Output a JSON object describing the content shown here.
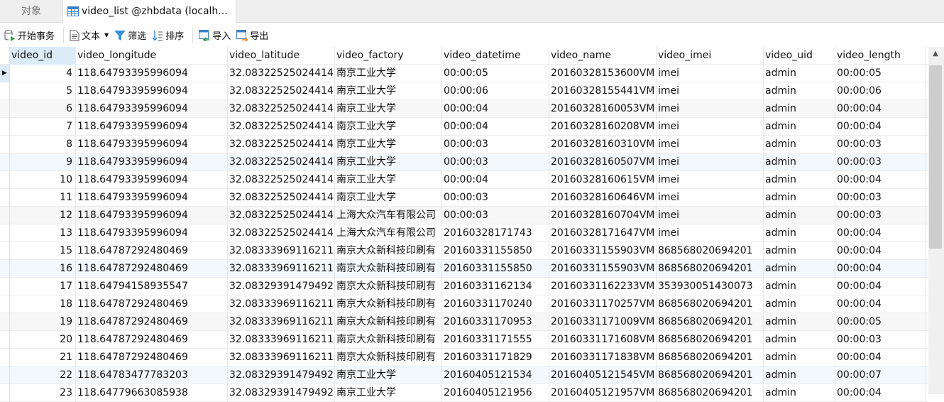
{
  "tabs": {
    "objects": "对象",
    "active": "video_list @zhbdata (localh..."
  },
  "toolbar": {
    "begin_transaction": "开始事务",
    "text": "文本",
    "filter": "筛选",
    "sort": "排序",
    "import": "导入",
    "export": "导出"
  },
  "columns": [
    "video_id",
    "video_longitude",
    "video_latitude",
    "video_factory",
    "video_datetime",
    "video_name",
    "video_imei",
    "video_uid",
    "video_length"
  ],
  "rows": [
    [
      "4",
      "118.64793395996094",
      "32.08322525024414",
      "南京工业大学",
      "00:00:05",
      "20160328153600VM",
      "imei",
      "admin",
      "00:00:05"
    ],
    [
      "5",
      "118.64793395996094",
      "32.08322525024414",
      "南京工业大学",
      "00:00:06",
      "20160328155441VM",
      "imei",
      "admin",
      "00:00:06"
    ],
    [
      "6",
      "118.64793395996094",
      "32.08322525024414",
      "南京工业大学",
      "00:00:04",
      "20160328160053VM",
      "imei",
      "admin",
      "00:00:04"
    ],
    [
      "7",
      "118.64793395996094",
      "32.08322525024414",
      "南京工业大学",
      "00:00:04",
      "20160328160208VM",
      "imei",
      "admin",
      "00:00:04"
    ],
    [
      "8",
      "118.64793395996094",
      "32.08322525024414",
      "南京工业大学",
      "00:00:03",
      "20160328160310VM",
      "imei",
      "admin",
      "00:00:03"
    ],
    [
      "9",
      "118.64793395996094",
      "32.08322525024414",
      "南京工业大学",
      "00:00:03",
      "20160328160507VM",
      "imei",
      "admin",
      "00:00:03"
    ],
    [
      "10",
      "118.64793395996094",
      "32.08322525024414",
      "南京工业大学",
      "00:00:04",
      "20160328160615VM",
      "imei",
      "admin",
      "00:00:04"
    ],
    [
      "11",
      "118.64793395996094",
      "32.08322525024414",
      "南京工业大学",
      "00:00:03",
      "20160328160646VM",
      "imei",
      "admin",
      "00:00:03"
    ],
    [
      "12",
      "118.64793395996094",
      "32.08322525024414",
      "上海大众汽车有限公司",
      "00:00:03",
      "20160328160704VM",
      "imei",
      "admin",
      "00:00:03"
    ],
    [
      "13",
      "118.64793395996094",
      "32.08322525024414",
      "上海大众汽车有限公司",
      "20160328171743",
      "20160328171647VM",
      "imei",
      "admin",
      "00:00:04"
    ],
    [
      "15",
      "118.64787292480469",
      "32.08333969116211",
      "南京大众新科技印刷有",
      "20160331155850",
      "20160331155903VM",
      "868568020694201",
      "admin",
      "00:00:04"
    ],
    [
      "16",
      "118.64787292480469",
      "32.08333969116211",
      "南京大众新科技印刷有",
      "20160331155850",
      "20160331155903VM",
      "868568020694201",
      "admin",
      "00:00:04"
    ],
    [
      "17",
      "118.64794158935547",
      "32.08329391479492",
      "南京大众新科技印刷有",
      "20160331162134",
      "20160331162233VM",
      "353930051430073",
      "admin",
      "00:00:04"
    ],
    [
      "18",
      "118.64787292480469",
      "32.08333969116211",
      "南京大众新科技印刷有",
      "20160331170240",
      "20160331170257VM",
      "868568020694201",
      "admin",
      "00:00:04"
    ],
    [
      "19",
      "118.64787292480469",
      "32.08333969116211",
      "南京大众新科技印刷有",
      "20160331170953",
      "20160331171009VM",
      "868568020694201",
      "admin",
      "00:00:05"
    ],
    [
      "20",
      "118.64787292480469",
      "32.08333969116211",
      "南京大众新科技印刷有",
      "20160331171555",
      "20160331171608VM",
      "868568020694201",
      "admin",
      "00:00:03"
    ],
    [
      "21",
      "118.64787292480469",
      "32.08333969116211",
      "南京大众新科技印刷有",
      "20160331171829",
      "20160331171838VM",
      "868568020694201",
      "admin",
      "00:00:04"
    ],
    [
      "22",
      "118.64783477783203",
      "32.08329391479492",
      "南京工业大学",
      "20160405121534",
      "20160405121545VM",
      "868568020694201",
      "admin",
      "00:00:07"
    ],
    [
      "23",
      "118.64779663085938",
      "32.08329391479492",
      "南京工业大学",
      "20160405121956",
      "20160405121957VM",
      "868568020694201",
      "admin",
      "00:00:04"
    ]
  ]
}
